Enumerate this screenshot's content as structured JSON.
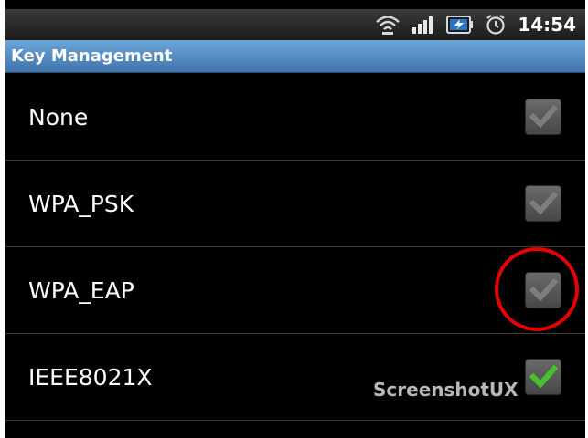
{
  "status_bar": {
    "time": "14:54",
    "icons": [
      "wifi-icon",
      "signal-bars-icon",
      "battery-icon",
      "alarm-icon"
    ]
  },
  "title_bar": {
    "title": "Key Management"
  },
  "list": {
    "items": [
      {
        "label": "None",
        "checkbox_state": "checked",
        "checkbox_color": "#7d7d7d"
      },
      {
        "label": "WPA_PSK",
        "checkbox_state": "checked",
        "checkbox_color": "#7d7d7d"
      },
      {
        "label": "WPA_EAP",
        "checkbox_state": "checked",
        "checkbox_color": "#7d7d7d"
      },
      {
        "label": "IEEE8021X",
        "checkbox_state": "checked",
        "checkbox_color": "#45c22d"
      }
    ]
  },
  "annotation": {
    "circle_color": "#e60000"
  },
  "watermark": {
    "text": "ScreenshotUX"
  },
  "colors": {
    "title_bar": "#4f86c0",
    "background": "#000000",
    "text": "#ffffff"
  }
}
